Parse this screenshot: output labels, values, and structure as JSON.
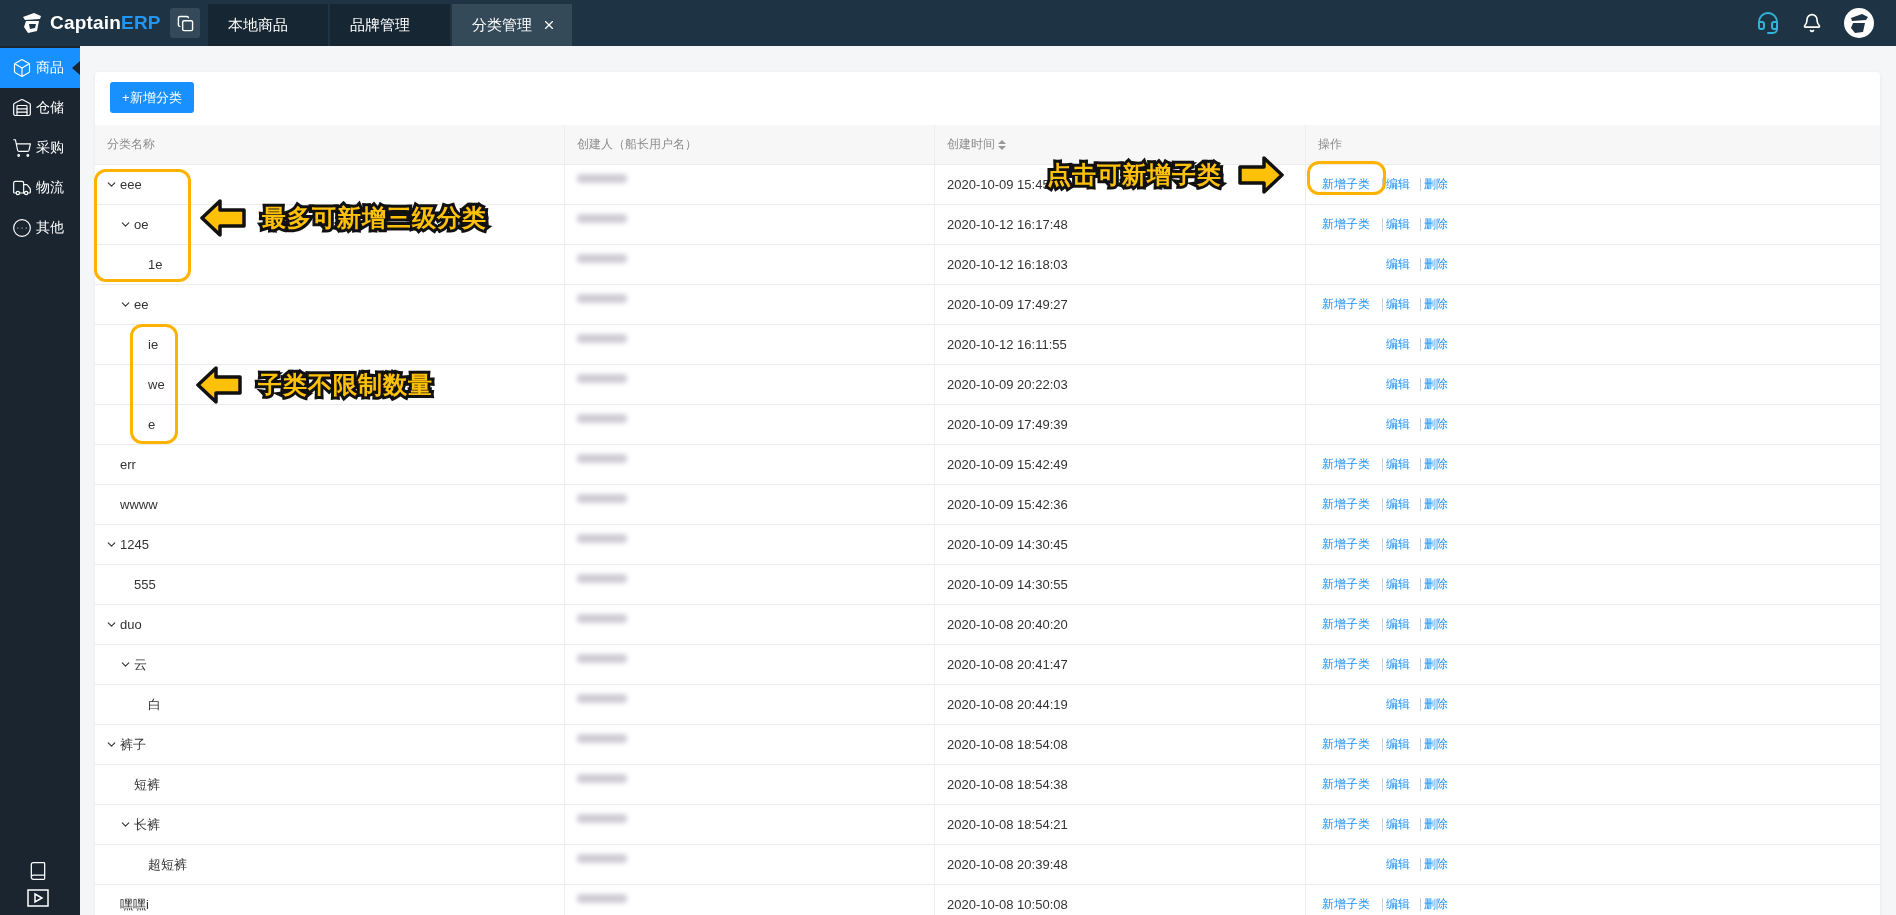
{
  "logo": {
    "text": "Captain",
    "accent": "ERP"
  },
  "tabs": [
    {
      "label": "本地商品",
      "selected": false,
      "closable": false
    },
    {
      "label": "品牌管理",
      "selected": false,
      "closable": false
    },
    {
      "label": "分类管理",
      "selected": true,
      "closable": true
    }
  ],
  "sidebar": {
    "items": [
      {
        "label": "商品",
        "selected": true
      },
      {
        "label": "仓储",
        "selected": false
      },
      {
        "label": "采购",
        "selected": false
      },
      {
        "label": "物流",
        "selected": false
      },
      {
        "label": "其他",
        "selected": false
      }
    ]
  },
  "add_button": "+新增分类",
  "table": {
    "columns": [
      {
        "label": "分类名称",
        "sortable": false
      },
      {
        "label": "创建人（船长用户名）",
        "sortable": false
      },
      {
        "label": "创建时间",
        "sortable": true
      },
      {
        "label": "操作",
        "sortable": false
      }
    ],
    "rows": [
      {
        "name": "eee",
        "created": "2020-10-09 15:45",
        "expanded": true,
        "actions": [
          {
            "kind": "add",
            "label": "新增子类"
          },
          {
            "kind": "edit",
            "label": "编辑"
          },
          {
            "kind": "delete",
            "label": "删除"
          }
        ],
        "children": [
          {
            "name": "oe",
            "created": "2020-10-12 16:17:48",
            "expanded": true,
            "actions": [
              {
                "kind": "add",
                "label": "新增子类"
              },
              {
                "kind": "edit",
                "label": "编辑"
              },
              {
                "kind": "delete",
                "label": "删除"
              }
            ],
            "children": [
              {
                "name": "1e",
                "created": "2020-10-12 16:18:03",
                "actions": [
                  {
                    "kind": "edit",
                    "label": "编辑"
                  },
                  {
                    "kind": "delete",
                    "label": "删除"
                  }
                ]
              }
            ]
          },
          {
            "name": "ee",
            "created": "2020-10-09 17:49:27",
            "expanded": true,
            "actions": [
              {
                "kind": "add",
                "label": "新增子类"
              },
              {
                "kind": "edit",
                "label": "编辑"
              },
              {
                "kind": "delete",
                "label": "删除"
              }
            ],
            "children": [
              {
                "name": "ie",
                "created": "2020-10-12 16:11:55",
                "actions": [
                  {
                    "kind": "edit",
                    "label": "编辑"
                  },
                  {
                    "kind": "delete",
                    "label": "删除"
                  }
                ]
              },
              {
                "name": "we",
                "created": "2020-10-09 20:22:03",
                "actions": [
                  {
                    "kind": "edit",
                    "label": "编辑"
                  },
                  {
                    "kind": "delete",
                    "label": "删除"
                  }
                ]
              },
              {
                "name": "e",
                "created": "2020-10-09 17:49:39",
                "actions": [
                  {
                    "kind": "edit",
                    "label": "编辑"
                  },
                  {
                    "kind": "delete",
                    "label": "删除"
                  }
                ]
              }
            ]
          }
        ]
      },
      {
        "name": "err",
        "created": "2020-10-09 15:42:49",
        "actions": [
          {
            "kind": "add",
            "label": "新增子类"
          },
          {
            "kind": "edit",
            "label": "编辑"
          },
          {
            "kind": "delete",
            "label": "删除"
          }
        ]
      },
      {
        "name": "wwww",
        "created": "2020-10-09 15:42:36",
        "actions": [
          {
            "kind": "add",
            "label": "新增子类"
          },
          {
            "kind": "edit",
            "label": "编辑"
          },
          {
            "kind": "delete",
            "label": "删除"
          }
        ]
      },
      {
        "name": "1245",
        "created": "2020-10-09 14:30:45",
        "expanded": true,
        "actions": [
          {
            "kind": "add",
            "label": "新增子类"
          },
          {
            "kind": "edit",
            "label": "编辑"
          },
          {
            "kind": "delete",
            "label": "删除"
          }
        ],
        "children": [
          {
            "name": "555",
            "created": "2020-10-09 14:30:55",
            "actions": [
              {
                "kind": "add",
                "label": "新增子类"
              },
              {
                "kind": "edit",
                "label": "编辑"
              },
              {
                "kind": "delete",
                "label": "删除"
              }
            ]
          }
        ]
      },
      {
        "name": "duo",
        "created": "2020-10-08 20:40:20",
        "expanded": true,
        "actions": [
          {
            "kind": "add",
            "label": "新增子类"
          },
          {
            "kind": "edit",
            "label": "编辑"
          },
          {
            "kind": "delete",
            "label": "删除"
          }
        ],
        "children": [
          {
            "name": "云",
            "created": "2020-10-08 20:41:47",
            "expanded": true,
            "actions": [
              {
                "kind": "add",
                "label": "新增子类"
              },
              {
                "kind": "edit",
                "label": "编辑"
              },
              {
                "kind": "delete",
                "label": "删除"
              }
            ],
            "children": [
              {
                "name": "白",
                "created": "2020-10-08 20:44:19",
                "actions": [
                  {
                    "kind": "edit",
                    "label": "编辑"
                  },
                  {
                    "kind": "delete",
                    "label": "删除"
                  }
                ]
              }
            ]
          }
        ]
      },
      {
        "name": "裤子",
        "created": "2020-10-08 18:54:08",
        "expanded": true,
        "actions": [
          {
            "kind": "add",
            "label": "新增子类"
          },
          {
            "kind": "edit",
            "label": "编辑"
          },
          {
            "kind": "delete",
            "label": "删除"
          }
        ],
        "children": [
          {
            "name": "短裤",
            "created": "2020-10-08 18:54:38",
            "actions": [
              {
                "kind": "add",
                "label": "新增子类"
              },
              {
                "kind": "edit",
                "label": "编辑"
              },
              {
                "kind": "delete",
                "label": "删除"
              }
            ]
          },
          {
            "name": "长裤",
            "created": "2020-10-08 18:54:21",
            "expanded": true,
            "actions": [
              {
                "kind": "add",
                "label": "新增子类"
              },
              {
                "kind": "edit",
                "label": "编辑"
              },
              {
                "kind": "delete",
                "label": "删除"
              }
            ],
            "children": [
              {
                "name": "超短裤",
                "created": "2020-10-08 20:39:48",
                "actions": [
                  {
                    "kind": "edit",
                    "label": "编辑"
                  },
                  {
                    "kind": "delete",
                    "label": "删除"
                  }
                ]
              }
            ]
          }
        ]
      },
      {
        "name": "嘿嘿i",
        "created": "2020-10-08 10:50:08",
        "actions": [
          {
            "kind": "add",
            "label": "新增子类"
          },
          {
            "kind": "edit",
            "label": "编辑"
          },
          {
            "kind": "delete",
            "label": "删除"
          }
        ]
      }
    ]
  },
  "annotations": [
    {
      "text": "最多可新增三级分类",
      "kind": "left"
    },
    {
      "text": "子类不限制数量",
      "kind": "left"
    },
    {
      "text": "点击可新增子类",
      "kind": "right"
    }
  ]
}
